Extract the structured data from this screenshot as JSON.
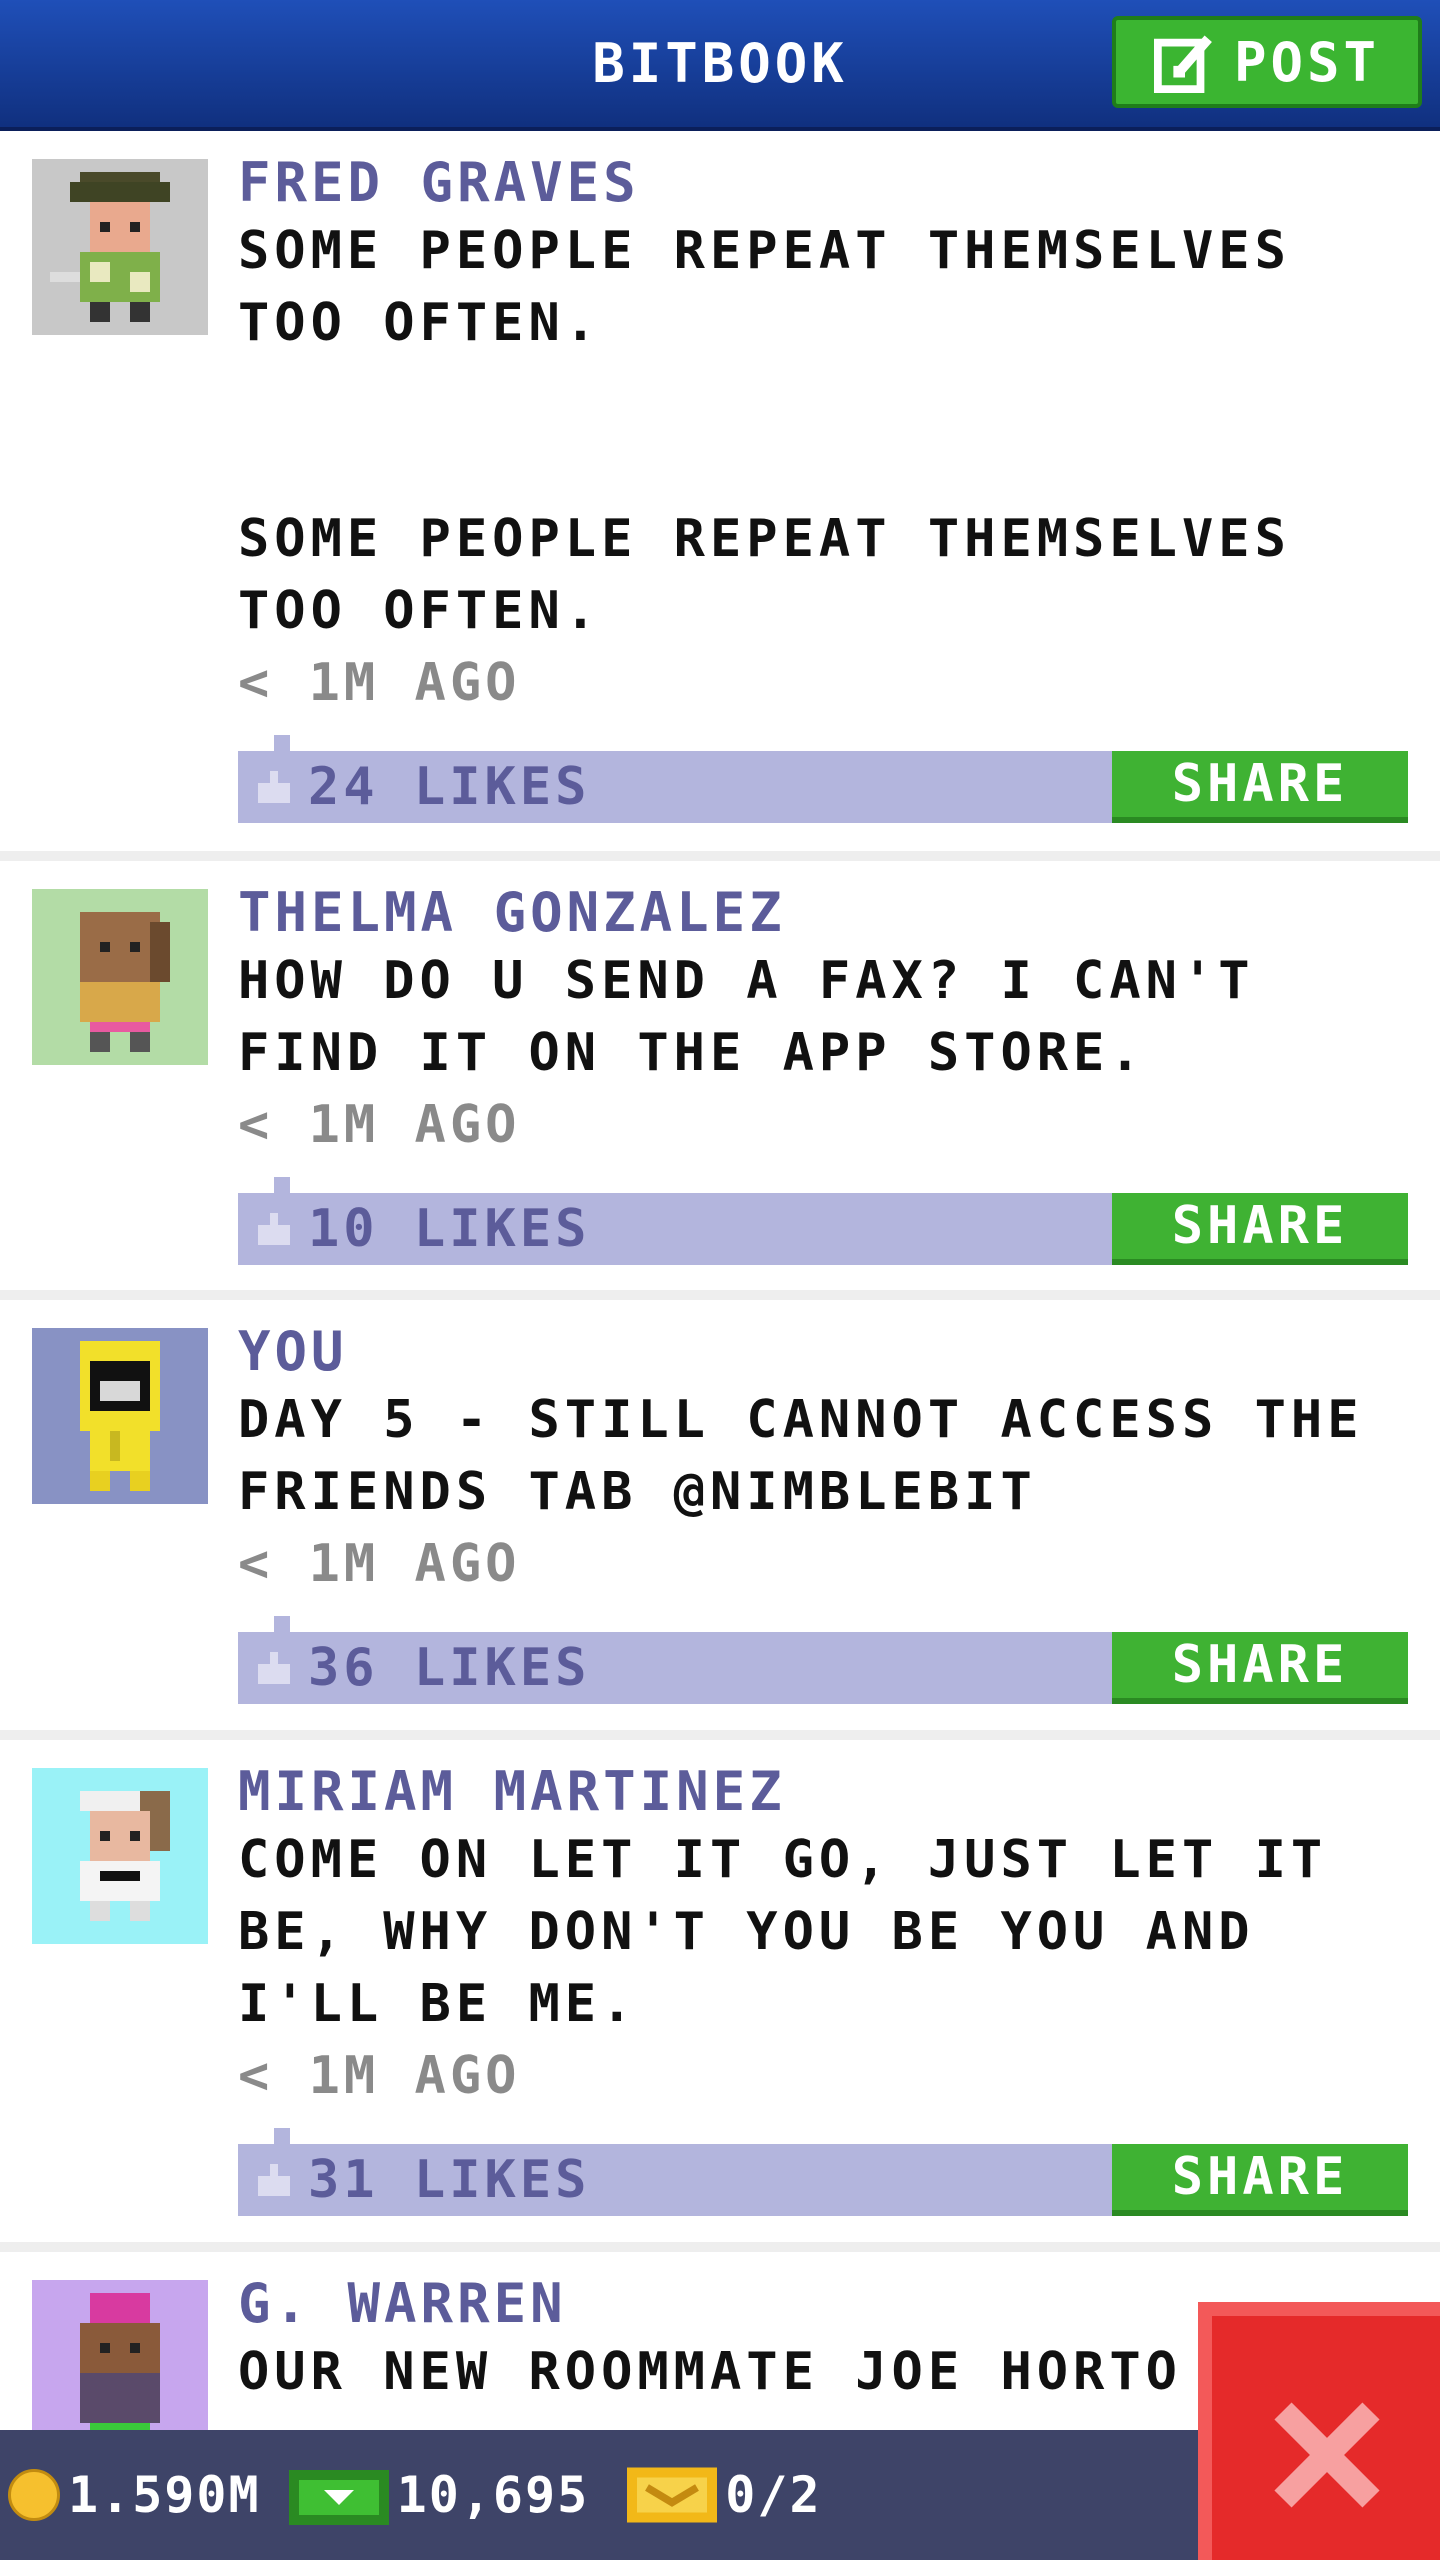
{
  "header": {
    "title": "BITBOOK",
    "post_label": "POST"
  },
  "posts": [
    {
      "author": "FRED GRAVES",
      "text": "SOME PEOPLE REPEAT THEMSELVES TOO OFTEN.\n\n\nSOME PEOPLE REPEAT THEMSELVES TOO OFTEN.",
      "time": "< 1M AGO",
      "likes": "24 LIKES",
      "share": "SHARE",
      "avatar_bg": "#c8c8c8"
    },
    {
      "author": "THELMA GONZALEZ",
      "text": "HOW DO U SEND A FAX? I CAN'T FIND IT ON THE APP STORE.",
      "time": "< 1M AGO",
      "likes": "10 LIKES",
      "share": "SHARE",
      "avatar_bg": "#b3dca6"
    },
    {
      "author": "YOU",
      "text": "DAY 5 - STILL CANNOT ACCESS THE FRIENDS TAB @NIMBLEBIT",
      "time": "< 1M AGO",
      "likes": "36 LIKES",
      "share": "SHARE",
      "avatar_bg": "#8892c4"
    },
    {
      "author": "MIRIAM MARTINEZ",
      "text": "COME ON LET IT GO, JUST LET IT BE, WHY DON'T YOU BE YOU AND I'LL BE ME.",
      "time": "< 1M AGO",
      "likes": "31 LIKES",
      "share": "SHARE",
      "avatar_bg": "#9af2f7"
    },
    {
      "author": "G. WARREN",
      "text": "OUR NEW ROOMMATE JOE HORTO",
      "avatar_bg": "#c7a6ee"
    }
  ],
  "bottom_bar": {
    "coins": "1.590M",
    "bux": "10,695",
    "tickets": "0/2"
  },
  "icons": {
    "post": "edit-icon",
    "like": "thumbs-up-icon",
    "coin": "coin-icon",
    "bux": "bux-icon",
    "ticket": "ticket-icon",
    "close": "close-icon"
  },
  "colors": {
    "header": "#1f4fb8",
    "accent_green": "#3fb233",
    "like_bar": "#b3b5dd",
    "author": "#5c5c9a",
    "close": "#e52a2a"
  }
}
